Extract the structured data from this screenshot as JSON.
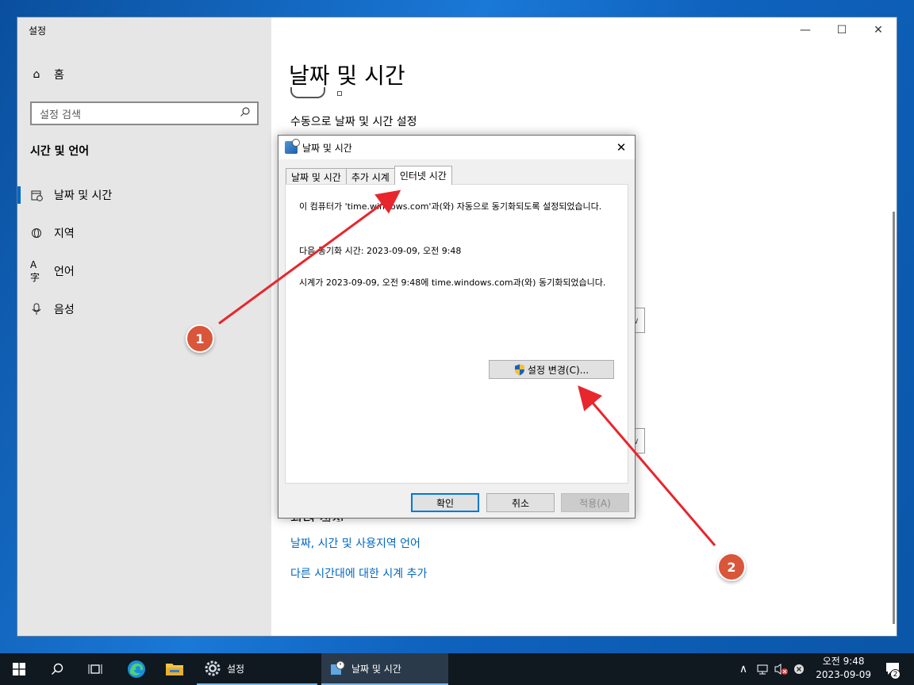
{
  "settings": {
    "app_title": "설정",
    "nav_home": "홈",
    "search_placeholder": "설정 검색",
    "section": "시간 및 언어",
    "nav_items": [
      "날짜 및 시간",
      "지역",
      "언어",
      "음성"
    ],
    "page_title": "날짜 및 시간",
    "manual_label": "수동으로 날짜 및 시간 설정",
    "related_heading": "관련 설정",
    "link_region": "날짜, 시간 및 사용지역 언어",
    "link_clocks": "다른 시간대에 대한 시계 추가"
  },
  "dialog": {
    "title": "날짜 및 시간",
    "tabs": [
      "날짜 및 시간",
      "추가 시계",
      "인터넷 시간"
    ],
    "selected_tab": "인터넷 시간",
    "line1": "이 컴퓨터가 'time.windows.com'과(와) 자동으로 동기화되도록 설정되었습니다.",
    "line2": "다음 동기화 시간: 2023-09-09, 오전 9:48",
    "line3": "시계가 2023-09-09, 오전 9:48에 time.windows.com과(와) 동기화되었습니다.",
    "change_button": "설정 변경(C)...",
    "ok": "확인",
    "cancel": "취소",
    "apply": "적용(A)"
  },
  "annotations": [
    "1",
    "2"
  ],
  "annotation_color": "#e8262d",
  "taskbar": {
    "settings_label": "설정",
    "datetime_label": "날짜 및 시간",
    "time": "오전 9:48",
    "date": "2023-09-09",
    "notification_count": "2"
  }
}
